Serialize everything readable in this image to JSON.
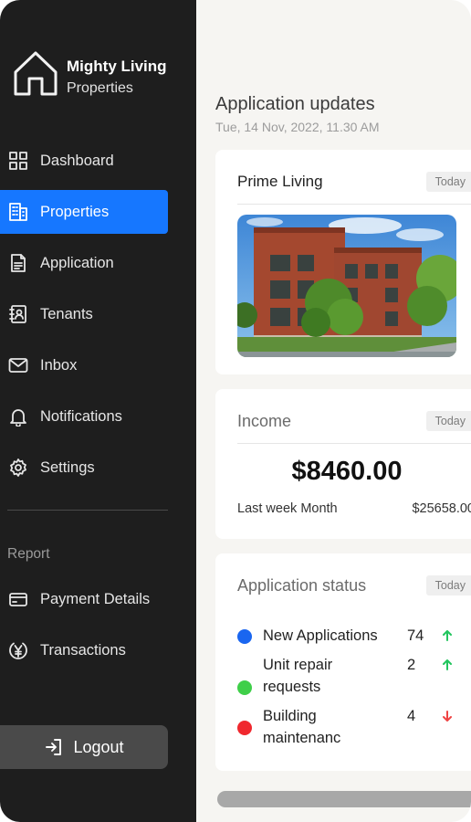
{
  "brand": {
    "name": "Mighty Living",
    "sub": "Properties",
    "icon": "house-icon"
  },
  "nav": [
    {
      "label": "Dashboard",
      "icon": "dashboard-grid-icon",
      "active": false
    },
    {
      "label": "Properties",
      "icon": "building-icon",
      "active": true
    },
    {
      "label": "Application",
      "icon": "document-icon",
      "active": false
    },
    {
      "label": "Tenants",
      "icon": "contact-book-icon",
      "active": false
    },
    {
      "label": "Inbox",
      "icon": "mail-icon",
      "active": false
    },
    {
      "label": "Notifications",
      "icon": "bell-icon",
      "active": false
    },
    {
      "label": "Settings",
      "icon": "gear-icon",
      "active": false
    }
  ],
  "report": {
    "label": "Report",
    "items": [
      {
        "label": "Payment Details",
        "icon": "credit-card-icon"
      },
      {
        "label": "Transactions",
        "icon": "yen-coin-icon"
      }
    ]
  },
  "logout": {
    "label": "Logout",
    "icon": "logout-icon"
  },
  "main": {
    "title": "Application updates",
    "date": "Tue, 14 Nov, 2022, 11.30 AM"
  },
  "property_card": {
    "title": "Prime Living",
    "badge": "Today"
  },
  "income_card": {
    "title": "Income",
    "badge": "Today",
    "amount": "$8460.00",
    "stat_label": "Last week Month",
    "stat_value": "$25658.00"
  },
  "status_card": {
    "title": "Application status",
    "badge": "Today",
    "items": [
      {
        "label": "New Applications",
        "count": "74",
        "trend": "up",
        "color": "#1a66f0"
      },
      {
        "label": "Unit repair requests",
        "count": "2",
        "trend": "up",
        "color": "#3fcf49"
      },
      {
        "label": "Building maintenanc",
        "count": "4",
        "trend": "down",
        "color": "#f0282e"
      }
    ]
  },
  "colors": {
    "accent": "#1677ff",
    "sidebar": "#1e1e1e",
    "up": "#22c55e",
    "down": "#ef4444"
  }
}
